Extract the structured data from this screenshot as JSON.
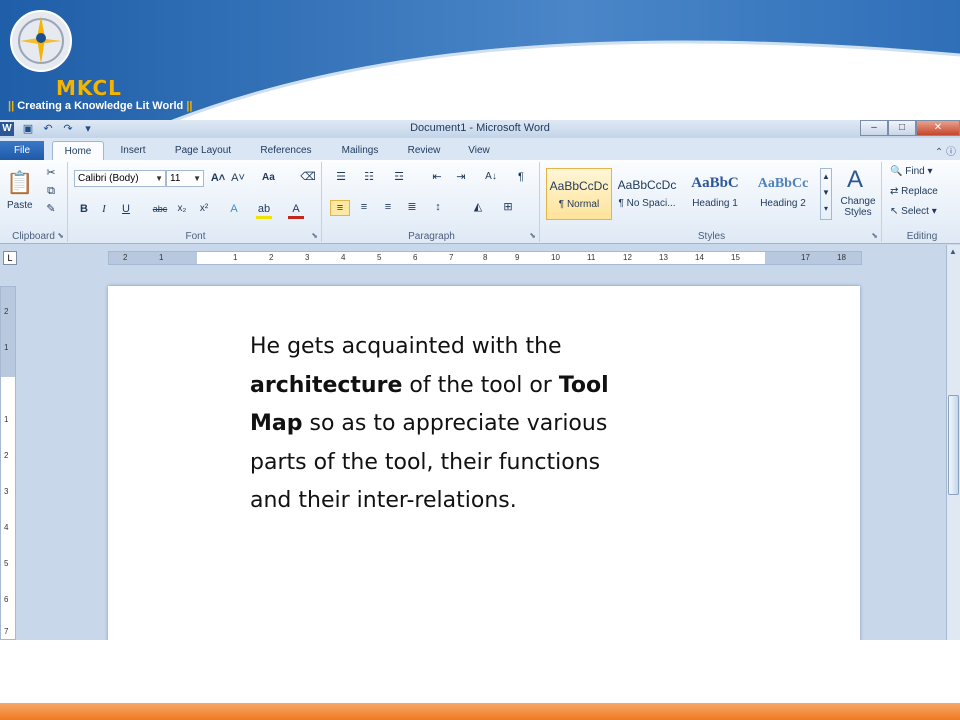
{
  "logo": {
    "name": "MKCL",
    "tagline_bar_left": "||",
    "tagline": "Creating a Knowledge Lit World",
    "tagline_bar_right": "||"
  },
  "window": {
    "title": "Document1 - Microsoft Word",
    "app_icon_letter": "W"
  },
  "tabs": [
    {
      "label": "File"
    },
    {
      "label": "Home"
    },
    {
      "label": "Insert"
    },
    {
      "label": "Page Layout"
    },
    {
      "label": "References"
    },
    {
      "label": "Mailings"
    },
    {
      "label": "Review"
    },
    {
      "label": "View"
    }
  ],
  "ribbon": {
    "clipboard": {
      "label": "Clipboard",
      "paste": "Paste"
    },
    "font": {
      "label": "Font",
      "font_name": "Calibri (Body)",
      "font_size": "11",
      "change_case": "Aa"
    },
    "paragraph": {
      "label": "Paragraph"
    },
    "styles": {
      "label": "Styles",
      "items": [
        {
          "sample": "AaBbCcDc",
          "name": "¶ Normal"
        },
        {
          "sample": "AaBbCcDc",
          "name": "¶ No Spaci..."
        },
        {
          "sample": "AaBbC",
          "name": "Heading 1"
        },
        {
          "sample": "AaBbCc",
          "name": "Heading 2"
        }
      ],
      "change_styles_line1": "Change",
      "change_styles_line2": "Styles"
    },
    "editing": {
      "label": "Editing",
      "find": "Find",
      "replace": "Replace",
      "select": "Select"
    }
  },
  "ruler": {
    "h_ticks": [
      "2",
      "1",
      "1",
      "2",
      "3",
      "4",
      "5",
      "6",
      "7",
      "8",
      "9",
      "10",
      "11",
      "12",
      "13",
      "14",
      "15",
      "17",
      "18"
    ],
    "v_ticks": [
      "2",
      "1",
      "1",
      "2",
      "3",
      "4",
      "5",
      "6",
      "7"
    ]
  },
  "document": {
    "line1": "He gets acquainted with the",
    "bold1": "architecture",
    "line2_rest": " of the tool or ",
    "bold2": "Tool",
    "bold3": "Map",
    "line3_rest": " so as to appreciate various",
    "line4": "parts of the tool, their functions",
    "line5": "and their inter-relations."
  },
  "colors": {
    "header_blue": "#1f5ea8",
    "logo_gold": "#f5b400",
    "footer_orange": "#ef7a22"
  }
}
